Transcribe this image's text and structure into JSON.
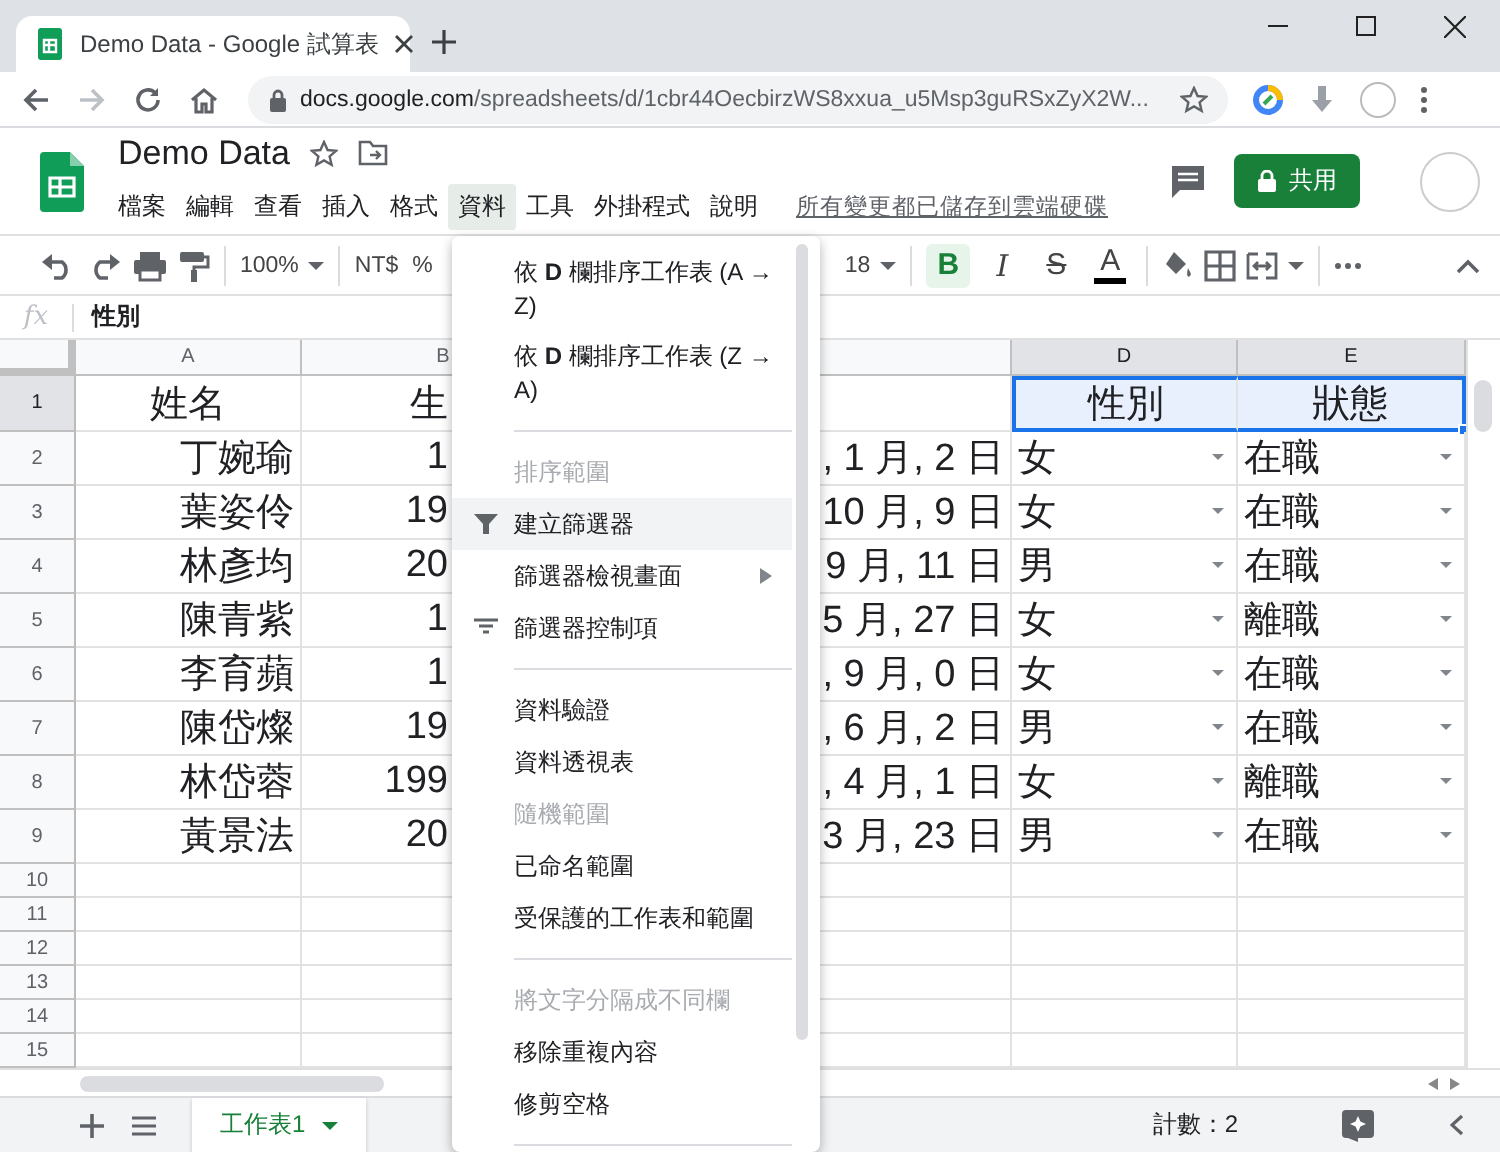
{
  "browser": {
    "tab_title": "Demo Data - Google 試算表",
    "url": {
      "host": "docs.google.com",
      "path": "/spreadsheets/d/1cbr44OecbirzWS8xxua_u5Msp3guRSxZyX2W..."
    },
    "forward_disabled": true
  },
  "document": {
    "title": "Demo Data",
    "menus": [
      {
        "label": "檔案",
        "selected": false
      },
      {
        "label": "編輯",
        "selected": false
      },
      {
        "label": "查看",
        "selected": false
      },
      {
        "label": "插入",
        "selected": false
      },
      {
        "label": "格式",
        "selected": false
      },
      {
        "label": "資料",
        "selected": true
      },
      {
        "label": "工具",
        "selected": false
      },
      {
        "label": "外掛程式",
        "selected": false
      },
      {
        "label": "說明",
        "selected": false
      }
    ],
    "save_status": "所有變更都已儲存到雲端硬碟",
    "share_label": "共用"
  },
  "toolbar": {
    "zoom": "100%",
    "currency": "NT$",
    "percent": "%",
    "font_size": "18",
    "format_buttons": [
      {
        "label": "B",
        "kind": "bold",
        "selected": true
      },
      {
        "label": "I",
        "kind": "italic",
        "selected": false
      },
      {
        "label": "S",
        "kind": "strikethrough",
        "selected": false
      },
      {
        "label": "A",
        "kind": "text_color",
        "selected": false
      }
    ]
  },
  "formula_bar": {
    "fx": "fx",
    "value": "性別"
  },
  "sheet": {
    "columns": [
      {
        "label": "A",
        "selected": false
      },
      {
        "label": "B",
        "selected": false
      },
      {
        "selected": false
      },
      {
        "label": "D",
        "selected": true
      },
      {
        "label": "E",
        "selected": true
      }
    ],
    "rows": [
      {
        "number": "1",
        "kind": "header",
        "selected": true,
        "dropdown": false,
        "cells": {
          "a": "姓名",
          "b": "生",
          "d": "性別",
          "e": "狀態"
        }
      },
      {
        "number": "2",
        "kind": "data",
        "selected": false,
        "dropdown": true,
        "cells": {
          "a": "丁婉瑜",
          "b": "1",
          "c": ", 1 月, 2 日",
          "d": "女",
          "e": "在職"
        }
      },
      {
        "number": "3",
        "kind": "data",
        "selected": false,
        "dropdown": true,
        "cells": {
          "a": "葉姿伶",
          "b": "19",
          "c": "10 月, 9 日",
          "d": "女",
          "e": "在職"
        }
      },
      {
        "number": "4",
        "kind": "data",
        "selected": false,
        "dropdown": true,
        "cells": {
          "a": "林彥均",
          "b": "20",
          "c": "9 月, 11 日",
          "d": "男",
          "e": "在職"
        }
      },
      {
        "number": "5",
        "kind": "data",
        "selected": false,
        "dropdown": true,
        "cells": {
          "a": "陳青紫",
          "b": "1",
          "c": "5 月, 27 日",
          "d": "女",
          "e": "離職"
        }
      },
      {
        "number": "6",
        "kind": "data",
        "selected": false,
        "dropdown": true,
        "cells": {
          "a": "李育蘋",
          "b": "1",
          "c": ", 9 月, 0 日",
          "d": "女",
          "e": "在職"
        }
      },
      {
        "number": "7",
        "kind": "data",
        "selected": false,
        "dropdown": true,
        "cells": {
          "a": "陳岱燦",
          "b": "19",
          "c": ", 6 月, 2 日",
          "d": "男",
          "e": "在職"
        }
      },
      {
        "number": "8",
        "kind": "data",
        "selected": false,
        "dropdown": true,
        "cells": {
          "a": "林岱蓉",
          "b": "199",
          "c": ", 4 月, 1 日",
          "d": "女",
          "e": "離職"
        }
      },
      {
        "number": "9",
        "kind": "data",
        "selected": false,
        "dropdown": true,
        "cells": {
          "a": "黃景法",
          "b": "20",
          "c": "3 月, 23 日",
          "d": "男",
          "e": "在職"
        }
      },
      {
        "number": "10",
        "kind": "empty",
        "selected": false,
        "dropdown": false
      },
      {
        "number": "11",
        "kind": "empty",
        "selected": false,
        "dropdown": false
      },
      {
        "number": "12",
        "kind": "empty",
        "selected": false,
        "dropdown": false
      },
      {
        "number": "13",
        "kind": "empty",
        "selected": false,
        "dropdown": false
      },
      {
        "number": "14",
        "kind": "empty",
        "selected": false,
        "dropdown": false
      },
      {
        "number": "15",
        "kind": "empty",
        "selected": false,
        "dropdown": false
      }
    ]
  },
  "menu": {
    "items": [
      {
        "kind": "item",
        "label": "依 **D** 欄排序工作表 (A → Z)",
        "disabled": false,
        "highlighted": false,
        "submenu": false
      },
      {
        "kind": "item",
        "label": "依 **D** 欄排序工作表 (Z → A)",
        "disabled": false,
        "highlighted": false,
        "submenu": false
      },
      {
        "kind": "separator"
      },
      {
        "kind": "item",
        "label": "排序範圍",
        "disabled": true,
        "highlighted": false,
        "submenu": false
      },
      {
        "kind": "filter",
        "label": "建立篩選器",
        "disabled": false,
        "highlighted": true,
        "submenu": false
      },
      {
        "kind": "item",
        "label": "篩選器檢視畫面",
        "disabled": false,
        "highlighted": false,
        "submenu": true
      },
      {
        "kind": "filter_controls",
        "label": "篩選器控制項",
        "disabled": false,
        "highlighted": false,
        "submenu": false
      },
      {
        "kind": "separator"
      },
      {
        "kind": "item",
        "label": "資料驗證",
        "disabled": false,
        "highlighted": false,
        "submenu": false
      },
      {
        "kind": "item",
        "label": "資料透視表",
        "disabled": false,
        "highlighted": false,
        "submenu": false
      },
      {
        "kind": "item",
        "label": "隨機範圍",
        "disabled": true,
        "highlighted": false,
        "submenu": false
      },
      {
        "kind": "item",
        "label": "已命名範圍",
        "disabled": false,
        "highlighted": false,
        "submenu": false
      },
      {
        "kind": "item",
        "label": "受保護的工作表和範圍",
        "disabled": false,
        "highlighted": false,
        "submenu": false
      },
      {
        "kind": "separator"
      },
      {
        "kind": "item",
        "label": "將文字分隔成不同欄",
        "disabled": true,
        "highlighted": false,
        "submenu": false
      },
      {
        "kind": "item",
        "label": "移除重複內容",
        "disabled": false,
        "highlighted": false,
        "submenu": false
      },
      {
        "kind": "item",
        "label": "修剪空格",
        "disabled": false,
        "highlighted": false,
        "submenu": false
      },
      {
        "kind": "separator"
      }
    ]
  },
  "footer": {
    "sheet_tabs": [
      {
        "label": "工作表1",
        "selected": true
      }
    ],
    "count": "計數：2"
  }
}
